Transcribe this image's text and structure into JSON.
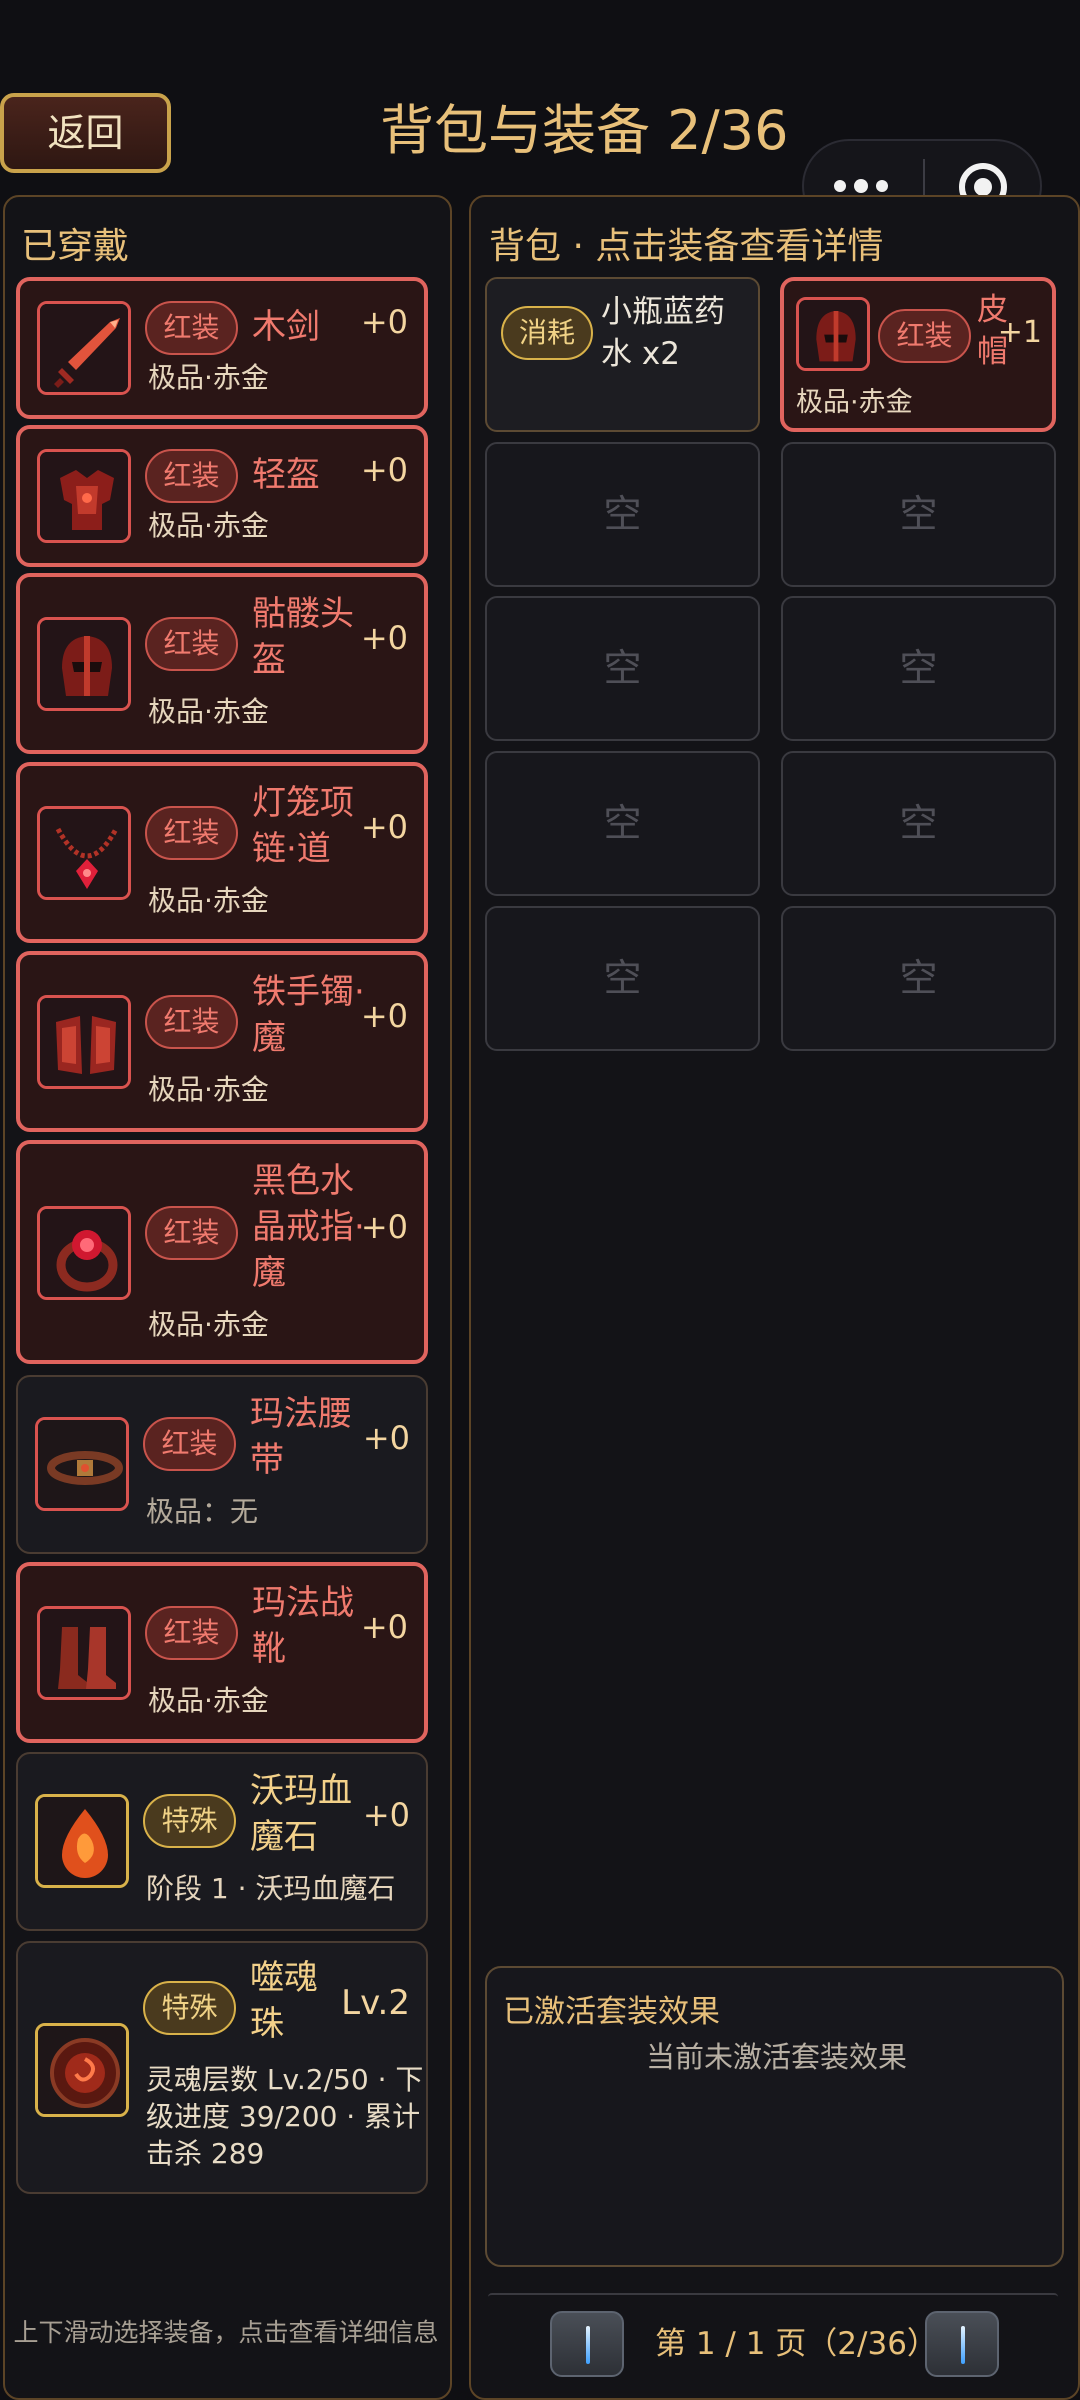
{
  "header": {
    "back_label": "返回",
    "title": "背包与装备 2/36"
  },
  "left_panel": {
    "title": "已穿戴",
    "hint": "上下滑动选择装备，点击查看详细信息",
    "items": [
      {
        "icon": "sword-icon",
        "badge": "红装",
        "name": "木剑",
        "plus": "+0",
        "sub": "极品·赤金"
      },
      {
        "icon": "armor-icon",
        "badge": "红装",
        "name": "轻盔",
        "plus": "+0",
        "sub": "极品·赤金"
      },
      {
        "icon": "helmet-icon",
        "badge": "红装",
        "name": "骷髅头盔",
        "plus": "+0",
        "sub": "极品·赤金"
      },
      {
        "icon": "necklace-icon",
        "badge": "红装",
        "name": "灯笼项链·道",
        "plus": "+0",
        "sub": "极品·赤金"
      },
      {
        "icon": "bracer-icon",
        "badge": "红装",
        "name": "铁手镯·魔",
        "plus": "+0",
        "sub": "极品·赤金"
      },
      {
        "icon": "ring-icon",
        "badge": "红装",
        "name": "黑色水晶戒指·魔",
        "plus": "+0",
        "sub": "极品·赤金"
      },
      {
        "icon": "belt-icon",
        "badge": "红装",
        "name": "玛法腰带",
        "plus": "+0",
        "sub": "极品：无"
      },
      {
        "icon": "boots-icon",
        "badge": "红装",
        "name": "玛法战靴",
        "plus": "+0",
        "sub": "极品·赤金"
      },
      {
        "icon": "bloodstone-icon",
        "badge": "特殊",
        "name": "沃玛血魔石",
        "plus": "+0",
        "sub": "阶段 1 · 沃玛血魔石"
      },
      {
        "icon": "soul-orb-icon",
        "badge": "特殊",
        "name": "噬魂珠",
        "plus": "Lv.2",
        "sub": "灵魂层数 Lv.2/50 · 下级进度 39/200 · 累计击杀 289"
      }
    ]
  },
  "right_panel": {
    "title": "背包 · 点击装备查看详情",
    "potion": {
      "badge": "消耗",
      "name": "小瓶蓝药水 x2"
    },
    "hat": {
      "icon": "leather-hat-icon",
      "badge": "红装",
      "name": "皮帽",
      "plus": "+1",
      "sub": "极品·赤金"
    },
    "empty_label": "空",
    "set_effects": {
      "title": "已激活套装效果",
      "empty_text": "当前未激活套装效果"
    },
    "pager": {
      "text": "第 1 / 1 页（2/36）"
    }
  },
  "colors": {
    "background": "#0f0f13",
    "accent_gold": "#e8c07a",
    "red_equip": "#e0645e",
    "red_text": "#f07a6e"
  }
}
